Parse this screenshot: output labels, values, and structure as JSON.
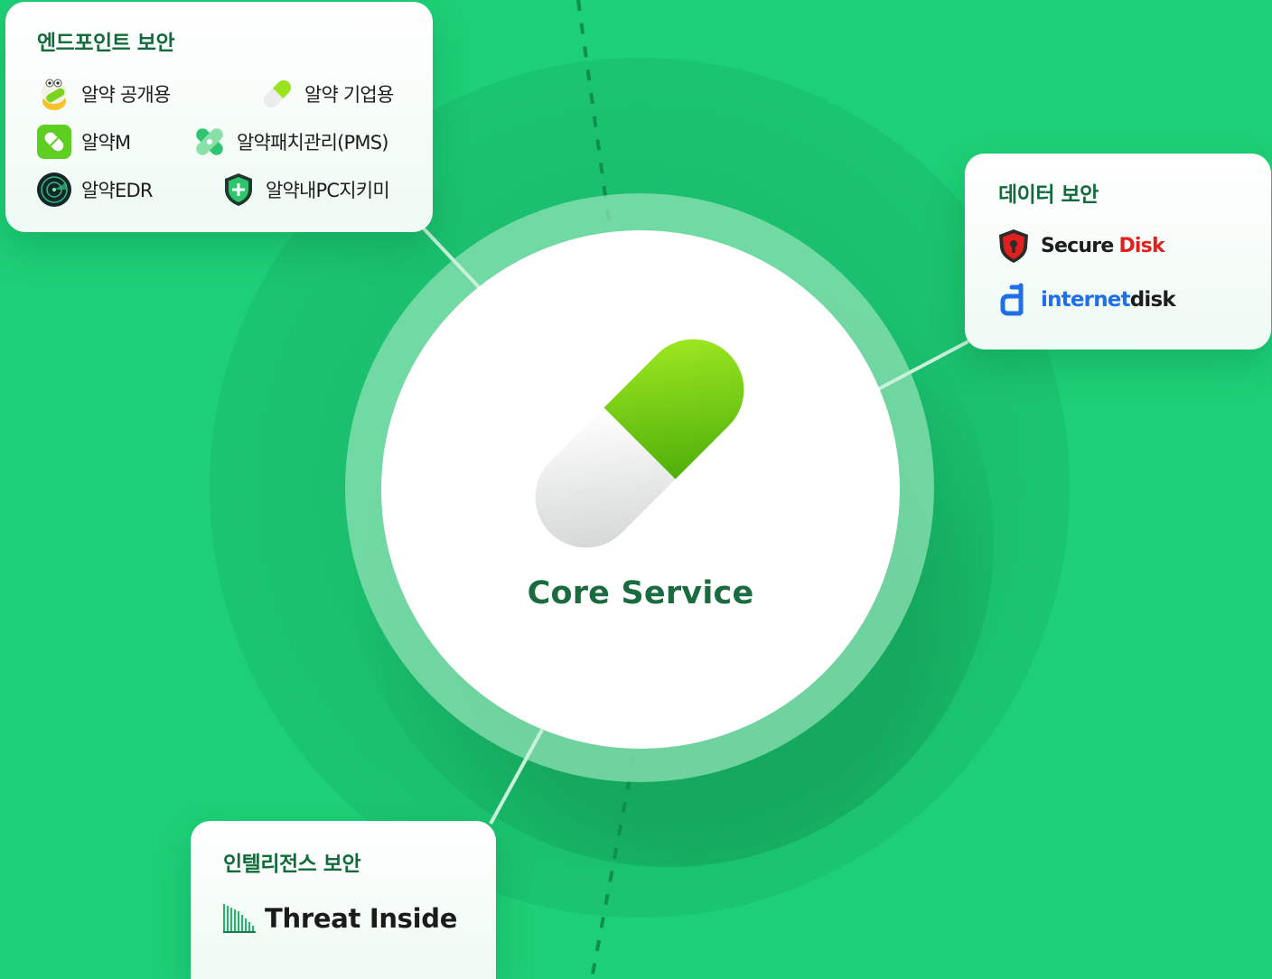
{
  "core": {
    "label": "Core Service"
  },
  "groups": {
    "endpoint": {
      "title": "엔드포인트 보안",
      "items": [
        {
          "label": "알약 공개용",
          "icon": "alyac-mascot-icon"
        },
        {
          "label": "알약 기업용",
          "icon": "pill-icon"
        },
        {
          "label": "알약M",
          "icon": "alyac-m-icon"
        },
        {
          "label": "알약패치관리(PMS)",
          "icon": "patch-bandage-icon"
        },
        {
          "label": "알약EDR",
          "icon": "radar-icon"
        },
        {
          "label": "알약내PC지키미",
          "icon": "shield-plus-icon"
        }
      ]
    },
    "data": {
      "title": "데이터 보안",
      "items": [
        {
          "label_a": "Secure",
          "label_b": "Disk",
          "icon": "shield-keyhole-icon"
        },
        {
          "label_a": "internet",
          "label_b": "disk",
          "icon": "internetdisk-logo-icon"
        }
      ]
    },
    "intel": {
      "title": "인텔리전스 보안",
      "items": [
        {
          "label": "Threat Inside",
          "icon": "threat-inside-logo-icon"
        }
      ]
    }
  },
  "colors": {
    "background": "#1dcf76",
    "accent_dark": "#136b3c",
    "pill_green": "#8fe01e",
    "secure_red": "#e0201f",
    "internetdisk_blue": "#1e6fe8"
  }
}
